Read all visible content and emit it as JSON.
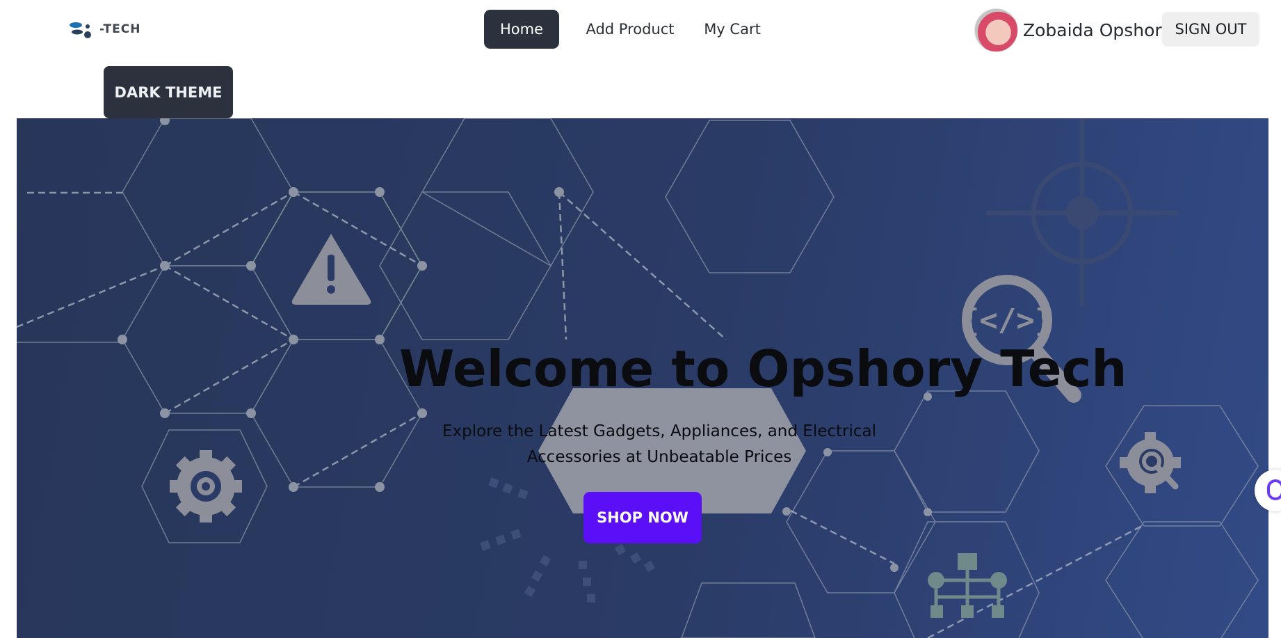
{
  "brand": {
    "logo_text": "-TECH",
    "logo_icon": "dragonfly-logo-icon"
  },
  "nav": {
    "items": [
      {
        "label": "Home",
        "active": true
      },
      {
        "label": "Add Product",
        "active": false
      },
      {
        "label": "My Cart",
        "active": false
      }
    ]
  },
  "user": {
    "name": "Zobaida Opshory",
    "avatar_icon": "user-avatar"
  },
  "actions": {
    "sign_out": "SIGN OUT",
    "theme_toggle": "DARK THEME"
  },
  "hero": {
    "title": "Welcome to Opshory Tech",
    "subtitle": "Explore the Latest Gadgets, Appliances, and Electrical Accessories at Unbeatable Prices",
    "cta": "SHOP NOW",
    "background_icons": [
      "warning-icon",
      "gear-icon",
      "code-search-icon",
      "gear-search-icon",
      "sitemap-icon",
      "crosshair-icon"
    ]
  },
  "colors": {
    "nav_active_bg": "#2c323d",
    "hero_bg": "#2a3b66",
    "cta_bg": "#5b0ff6",
    "signout_bg": "#efefef"
  }
}
